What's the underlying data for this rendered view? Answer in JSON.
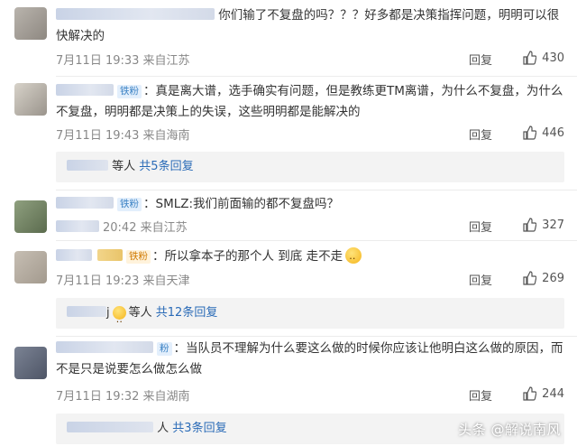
{
  "comments": [
    {
      "text": "你们输了不复盘的吗？？？好多都是决策指挥问题，明明可以很快解决的",
      "time": "7月11日 19:33 来自江苏",
      "reply_label": "回复",
      "likes": "430"
    },
    {
      "badge": "铁粉",
      "text": "：真是离大谱，选手确实有问题，但是教练更TM离谱，为什么不复盘，为什么不复盘，明明都是决策上的失误，这些明明都是能解决的",
      "time": "7月11日 19:43 来自海南",
      "reply_label": "回复",
      "likes": "446",
      "sub": {
        "prefix": "等人",
        "more": "共5条回复"
      }
    },
    {
      "badge": "铁粉",
      "text": "：SMLZ:我们前面输的都不复盘吗？",
      "time": "20:42 来自江苏",
      "reply_label": "回复",
      "likes": "327"
    },
    {
      "badge": "铁粉",
      "text": "：所以拿本子的那个人 到底 走不走",
      "time": "7月11日 19:23 来自天津",
      "reply_label": "回复",
      "likes": "269",
      "sub": {
        "initial": "j",
        "prefix": "等人",
        "more": "共12条回复"
      }
    },
    {
      "badge": "粉",
      "text": "：当队员不理解为什么要这么做的时候你应该让他明白这么做的原因，而不是只是说要怎么做怎么做",
      "time": "7月11日 19:32 来自湖南",
      "reply_label": "回复",
      "likes": "244",
      "sub": {
        "prefix": "人",
        "more": "共3条回复"
      }
    }
  ],
  "watermark": "头条 @解说南风"
}
